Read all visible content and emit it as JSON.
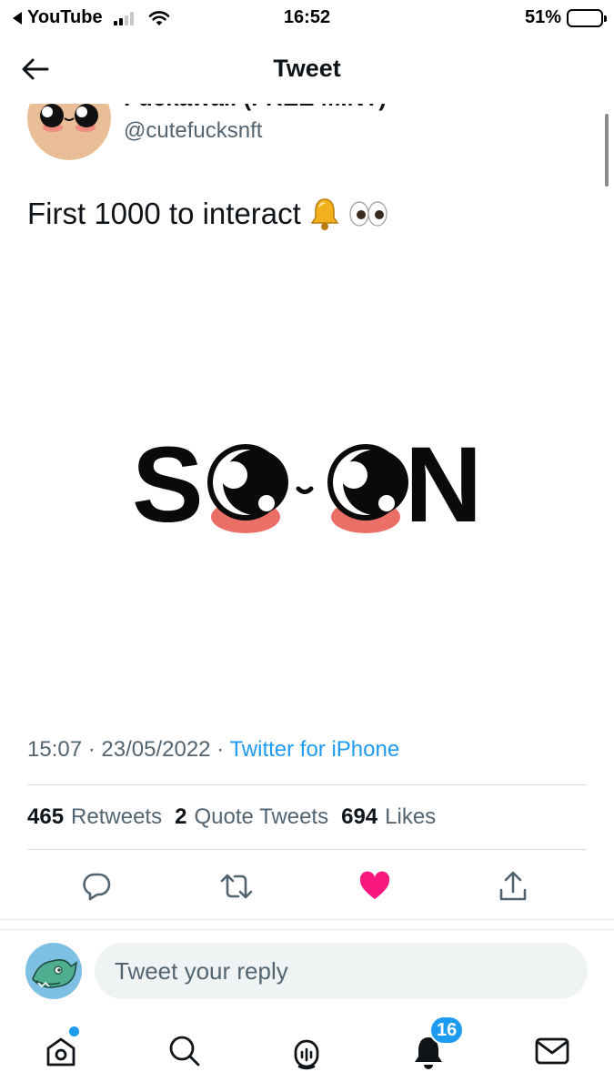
{
  "status_bar": {
    "back_app": "YouTube",
    "time": "16:52",
    "battery": "51%",
    "battery_level": 0.51,
    "signal_bars_active": 2,
    "signal_bars_total": 4
  },
  "header": {
    "title": "Tweet",
    "back_icon": "arrow-left-icon"
  },
  "tweet": {
    "author_name": "Fuckawaii (FREE MINT)",
    "author_handle": "@cutefucksnft",
    "text": "First 1000 to interact",
    "text_emojis": [
      "bell-emoji",
      "eyes-emoji"
    ],
    "media_alt": "SOON",
    "time": "15:07",
    "date": "23/05/2022",
    "separator": "·",
    "source": "Twitter for iPhone",
    "stats": {
      "retweets_count": "465",
      "retweets_label": "Retweets",
      "quotes_count": "2",
      "quotes_label": "Quote Tweets",
      "likes_count": "694",
      "likes_label": "Likes"
    },
    "actions": [
      "reply-icon",
      "retweet-icon",
      "like-icon",
      "share-icon"
    ],
    "liked": true,
    "like_color": "#f91880"
  },
  "reply": {
    "placeholder": "Tweet your reply"
  },
  "tabbar": {
    "items": [
      "home-icon",
      "search-icon",
      "spaces-icon",
      "notifications-icon",
      "messages-icon"
    ],
    "notifications_badge": "16"
  },
  "colors": {
    "accent": "#1d9bf0",
    "secondary_text": "#536471",
    "like": "#f91880"
  }
}
